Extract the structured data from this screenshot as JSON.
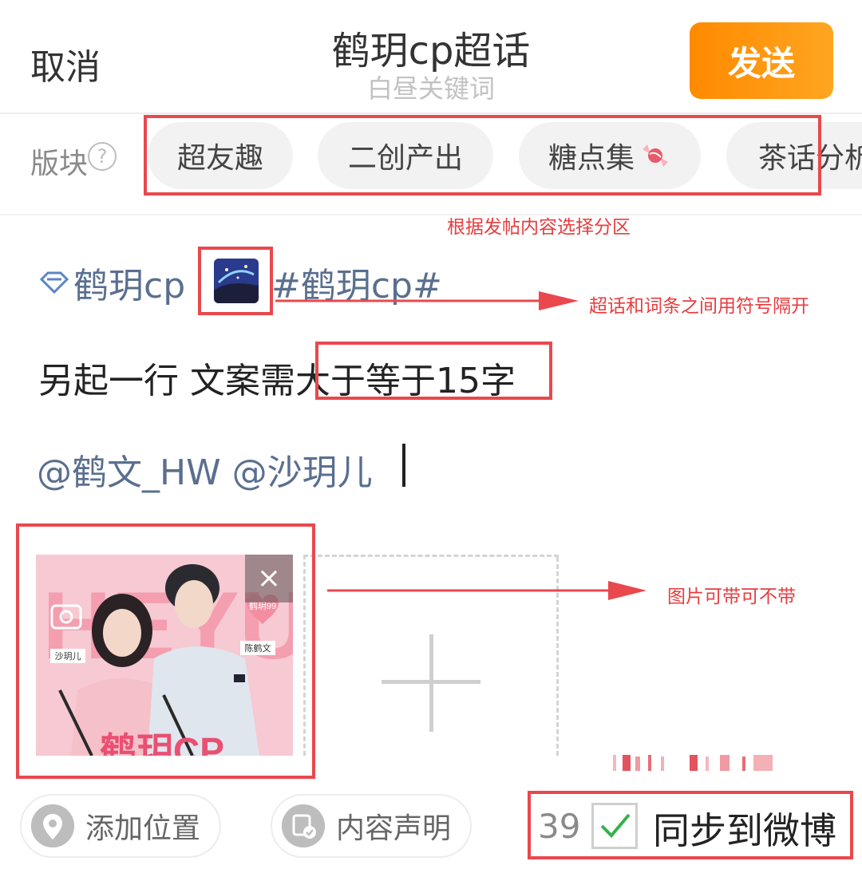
{
  "header": {
    "cancel": "取消",
    "title": "鹤玥cp超话",
    "subtitle": "白昼关键词",
    "send": "发送"
  },
  "sections": {
    "label": "版块",
    "help": "?",
    "chips": [
      "超友趣",
      "二创产出",
      "糖点集",
      "茶话分析"
    ]
  },
  "post": {
    "topic_name": "鹤玥cp",
    "hashtag": "#鹤玥cp#",
    "body": "另起一行 文案需大于等于15字",
    "mentions": "@鹤文_HW @沙玥儿"
  },
  "image": {
    "close": "×",
    "photo_text": {
      "big": "HEYUE",
      "tag_left": "沙玥儿",
      "tag_right": "陈鹤文",
      "heart": "鹤玥99",
      "bottom": "鹤玥CP"
    }
  },
  "bottom": {
    "location": "添加位置",
    "declaration": "内容声明",
    "count": "39",
    "sync": "同步到微博"
  },
  "annotations": {
    "sections_hint": "根据发帖内容选择分区",
    "separator_hint": "超话和词条之间用符号隔开",
    "image_hint": "图片可带可不带"
  },
  "colors": {
    "accent_orange": "#ff8a00",
    "link_blue": "#5a6f8f",
    "annotation_red": "#e9484d",
    "check_green": "#34b24a"
  }
}
